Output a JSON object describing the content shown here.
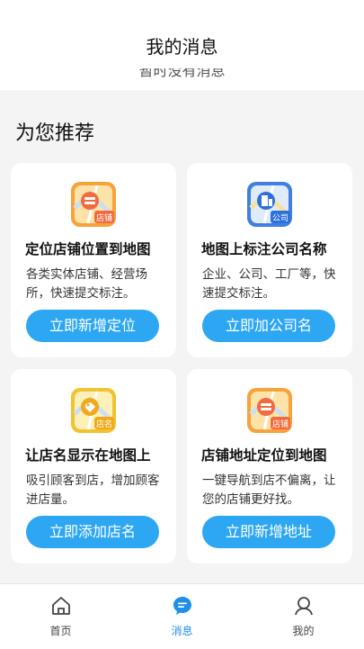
{
  "header": {
    "title": "我的消息",
    "empty_text": "暂时没有消息"
  },
  "section_title": "为您推荐",
  "cards": [
    {
      "icon": "store-map-icon",
      "badge": "店铺",
      "title": "定位店铺位置到地图",
      "desc": "各类实体店铺、经营场所，快速提交标注。",
      "button": "立即新增定位"
    },
    {
      "icon": "company-map-icon",
      "badge": "公司",
      "title": "地图上标注公司名称",
      "desc": "企业、公司、工厂等，快速提交标注。",
      "button": "立即加公司名"
    },
    {
      "icon": "store-name-map-icon",
      "badge": "店名",
      "title": "让店名显示在地图上",
      "desc": "吸引顾客到店，增加顾客进店量。",
      "button": "立即添加店名"
    },
    {
      "icon": "store-address-map-icon",
      "badge": "店铺",
      "title": "店铺地址定位到地图",
      "desc": "一键导航到店不偏离，让您的店铺更好找。",
      "button": "立即新增地址"
    }
  ],
  "tabs": [
    {
      "label": "首页",
      "icon": "home-icon",
      "active": false
    },
    {
      "label": "消息",
      "icon": "message-icon",
      "active": true
    },
    {
      "label": "我的",
      "icon": "user-icon",
      "active": false
    }
  ],
  "colors": {
    "accent": "#2ea7f2",
    "active_tab": "#1f8fe8",
    "background": "#f4f4f4"
  }
}
